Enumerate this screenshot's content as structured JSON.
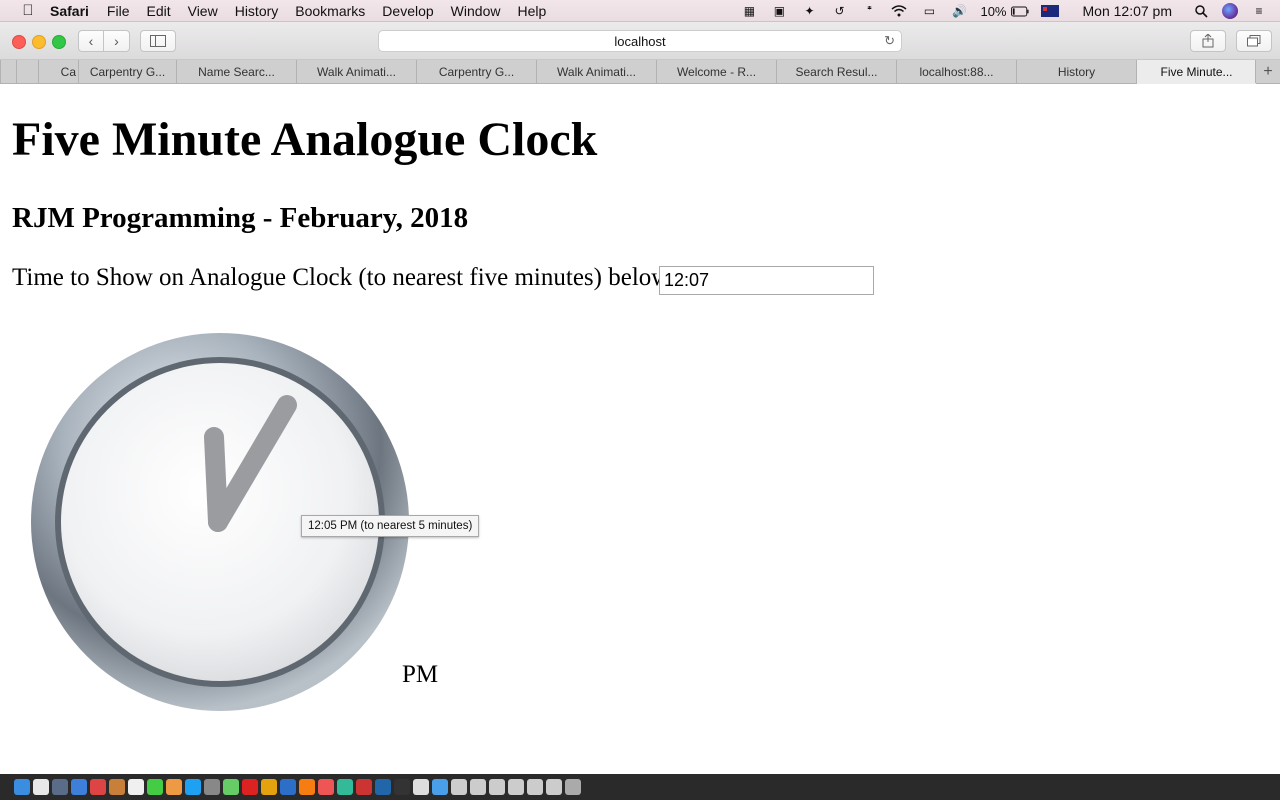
{
  "menubar": {
    "app_name": "Safari",
    "items": [
      "File",
      "Edit",
      "View",
      "History",
      "Bookmarks",
      "Develop",
      "Window",
      "Help"
    ],
    "battery": "10%",
    "clock": "Mon 12:07 pm"
  },
  "toolbar": {
    "address": "localhost"
  },
  "tabs": [
    {
      "label": "Ca"
    },
    {
      "label": "Carpentry G..."
    },
    {
      "label": "Name Searc..."
    },
    {
      "label": "Walk Animati..."
    },
    {
      "label": "Carpentry G..."
    },
    {
      "label": "Walk Animati..."
    },
    {
      "label": "Welcome - R..."
    },
    {
      "label": "Search Resul..."
    },
    {
      "label": "localhost:88..."
    },
    {
      "label": "History"
    },
    {
      "label": "Five Minute..."
    }
  ],
  "page": {
    "title": "Five Minute Analogue Clock",
    "subtitle": "RJM Programming - February, 2018",
    "prompt": "Time to Show on Analogue Clock (to nearest five minutes) below:",
    "time_value": "12:07",
    "ampm": "PM",
    "tooltip": "12:05 PM (to nearest 5 minutes)"
  },
  "colors": {
    "traffic_red": "#fc5f57",
    "traffic_yellow": "#fdbc2e",
    "traffic_green": "#33c748"
  }
}
